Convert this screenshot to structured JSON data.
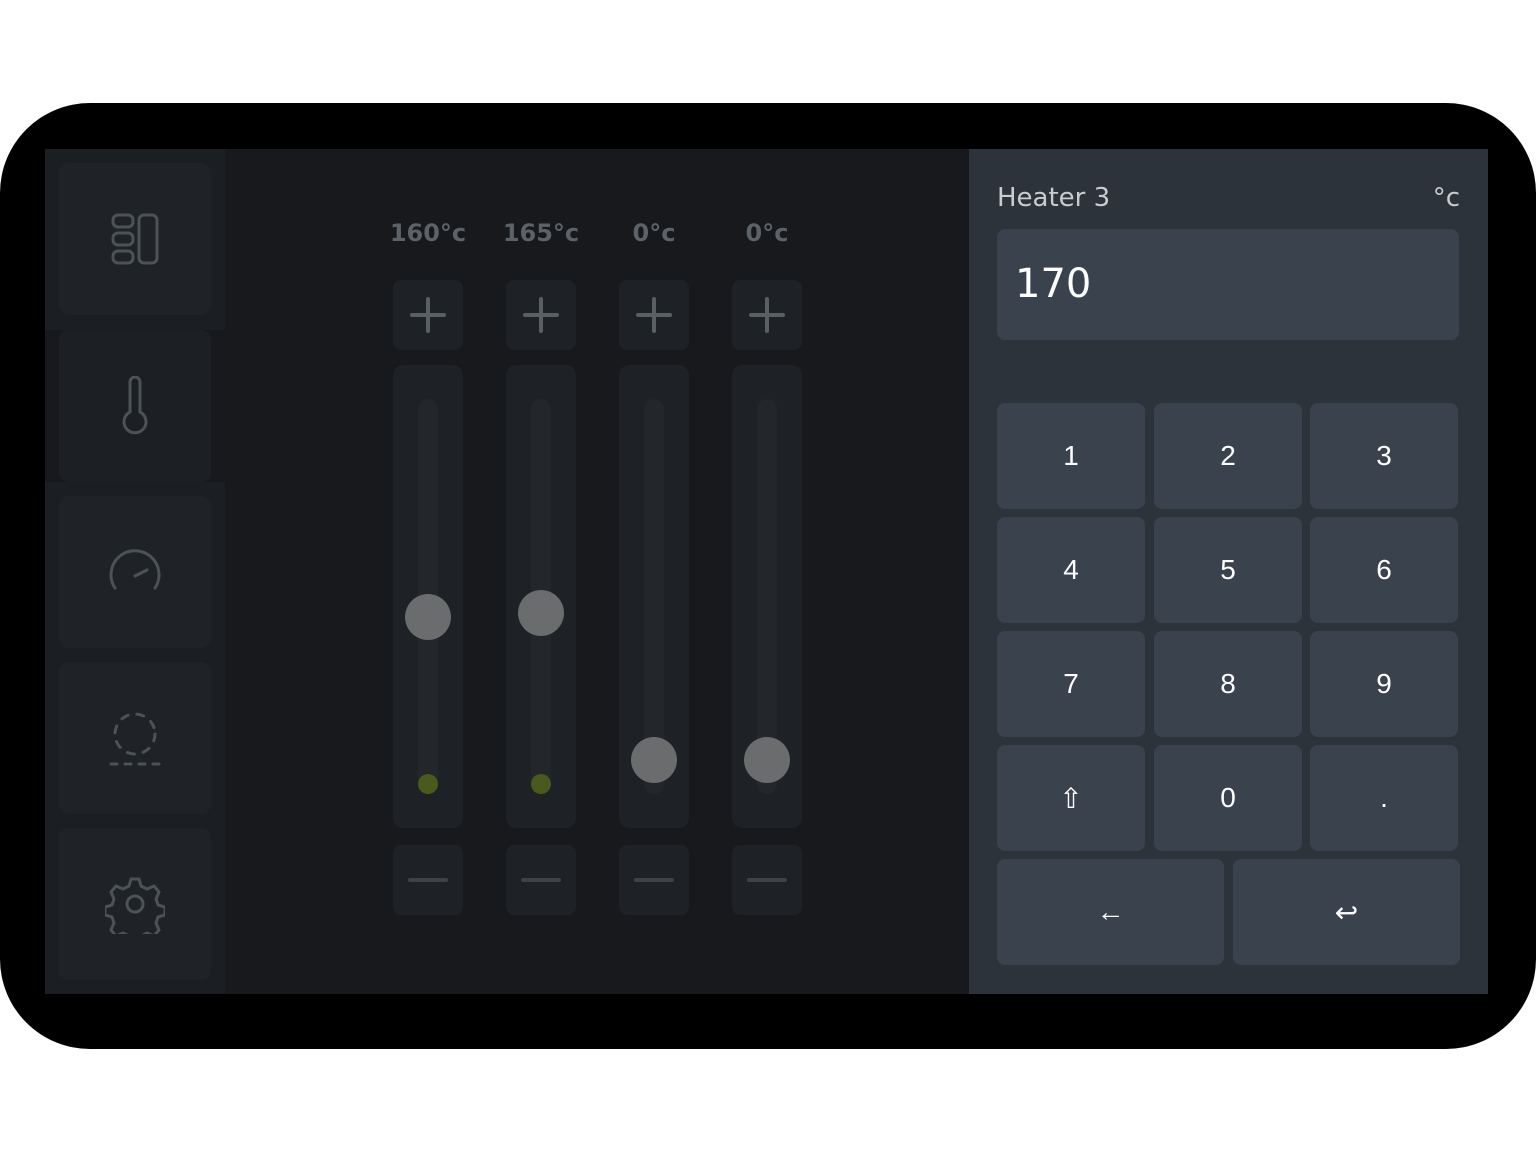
{
  "sidebar": {
    "items": [
      {
        "icon": "dashboard-icon",
        "active": false
      },
      {
        "icon": "thermometer-icon",
        "active": true
      },
      {
        "icon": "gauge-icon",
        "active": false
      },
      {
        "icon": "scan-frame-icon",
        "active": false
      },
      {
        "icon": "gear-icon",
        "active": false
      }
    ]
  },
  "heaters": [
    {
      "label": "160°c",
      "setpoint_fraction": 0.41,
      "indicator": true
    },
    {
      "label": "165°c",
      "setpoint_fraction": 0.42,
      "indicator": true
    },
    {
      "label": "0°c",
      "setpoint_fraction": 0.0,
      "indicator": false
    },
    {
      "label": "0°c",
      "setpoint_fraction": 0.0,
      "indicator": false
    }
  ],
  "controls": {
    "increase_icon": "plus-icon",
    "decrease_icon": "minus-icon"
  },
  "keypad": {
    "title": "Heater 3",
    "unit": "°c",
    "value": "170",
    "keys": [
      "1",
      "2",
      "3",
      "4",
      "5",
      "6",
      "7",
      "8",
      "9",
      "⇧",
      "0",
      "."
    ],
    "backspace": "←",
    "enter": "↩"
  },
  "colors": {
    "background": "#17191c",
    "panel": "#2d333b",
    "key": "#39424d",
    "indicator": "#485a1c",
    "thumb": "#6b6c6d"
  }
}
